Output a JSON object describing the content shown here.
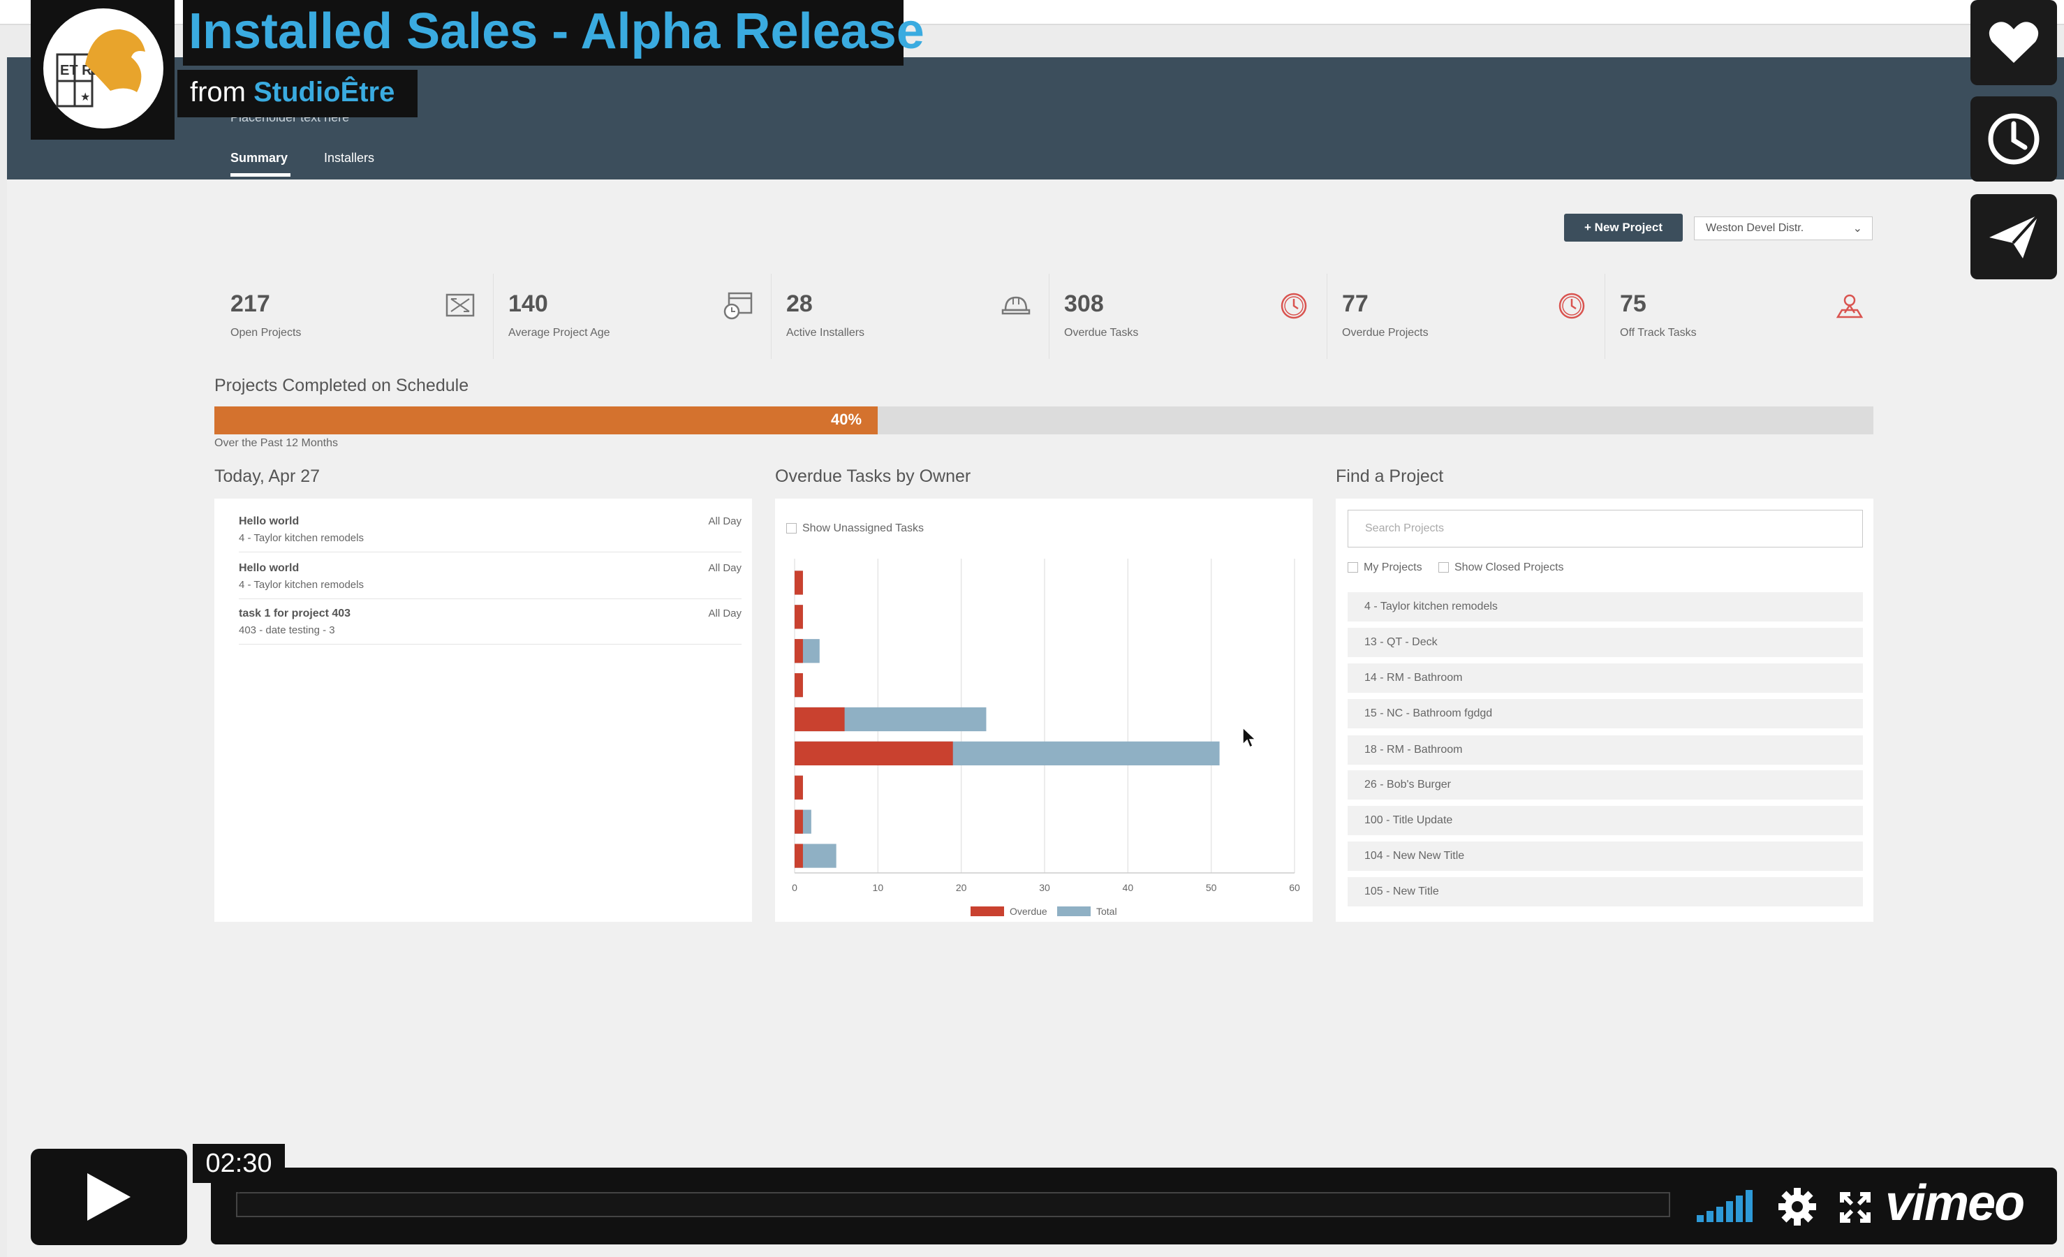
{
  "video": {
    "title": "Installed Sales - Alpha Release",
    "from_prefix": "from ",
    "from_channel": "StudioÊtre",
    "logo_letters": "ET RE",
    "timestamp": "02:30",
    "brand": "vimeo",
    "side_buttons": [
      "heart-icon",
      "clock-icon",
      "send-icon"
    ],
    "controls": [
      "play-icon",
      "volume-icon",
      "settings-icon",
      "fullscreen-icon"
    ]
  },
  "header": {
    "subtitle": "Placeholder text here",
    "tabs": [
      {
        "label": "Summary",
        "active": true
      },
      {
        "label": "Installers",
        "active": false
      }
    ]
  },
  "toolbar": {
    "new_project_label": "+ New Project",
    "distributor_selected": "Weston Devel Distr."
  },
  "stats": [
    {
      "value": "217",
      "label": "Open Projects",
      "icon": "blueprint-icon"
    },
    {
      "value": "140",
      "label": "Average Project Age",
      "icon": "calendar-clock-icon"
    },
    {
      "value": "28",
      "label": "Active Installers",
      "icon": "hardhat-icon"
    },
    {
      "value": "308",
      "label": "Overdue Tasks",
      "icon": "alarm-clock-icon"
    },
    {
      "value": "77",
      "label": "Overdue Projects",
      "icon": "alarm-clock-icon"
    },
    {
      "value": "75",
      "label": "Off Track Tasks",
      "icon": "map-pin-person-icon"
    }
  ],
  "schedule": {
    "title": "Projects Completed on Schedule",
    "percent_label": "40%",
    "percent": 40,
    "caption": "Over the Past 12 Months"
  },
  "today": {
    "title": "Today, Apr 27",
    "events": [
      {
        "title": "Hello world",
        "subtitle": "4 - Taylor kitchen remodels",
        "when": "All Day"
      },
      {
        "title": "Hello world",
        "subtitle": "4 - Taylor kitchen remodels",
        "when": "All Day"
      },
      {
        "title": "task 1 for project 403",
        "subtitle": "403 - date testing - 3",
        "when": "All Day"
      }
    ]
  },
  "overdue": {
    "title": "Overdue Tasks by Owner",
    "checkbox_label": "Show Unassigned Tasks"
  },
  "chart_data": {
    "type": "bar",
    "orientation": "horizontal",
    "title": "Overdue Tasks by Owner",
    "categories": [
      "",
      "",
      "",
      "",
      "",
      "",
      "",
      "",
      ""
    ],
    "series": [
      {
        "name": "Overdue",
        "color": "#c9412f",
        "values": [
          1,
          1,
          1,
          1,
          6,
          19,
          1,
          1,
          1
        ]
      },
      {
        "name": "Total",
        "color": "#8fb0c4",
        "values": [
          1,
          1,
          3,
          1,
          23,
          51,
          1,
          2,
          5
        ]
      }
    ],
    "xlim": [
      0,
      60
    ],
    "xticks": [
      "0",
      "10",
      "20",
      "30",
      "40",
      "50",
      "60"
    ],
    "grid": true,
    "legend": "bottom"
  },
  "find": {
    "title": "Find a Project",
    "search_placeholder": "Search Projects",
    "filter_my_projects": "My Projects",
    "filter_closed": "Show Closed Projects",
    "projects": [
      "4 - Taylor kitchen remodels",
      "13 - QT - Deck",
      "14 - RM - Bathroom",
      "15 - NC - Bathroom fgdgd",
      "18 - RM - Bathroom",
      "26 - Bob's Burger",
      "100 - Title Update",
      "104 - New New Title",
      "105 - New Title"
    ]
  }
}
